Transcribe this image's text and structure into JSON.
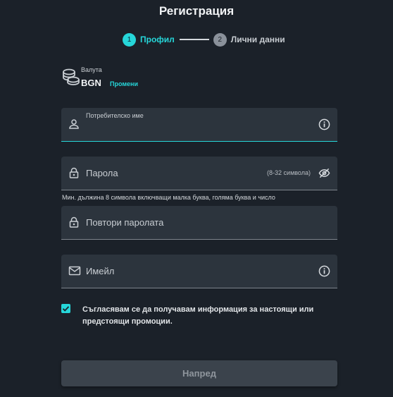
{
  "title": "Регистрация",
  "stepper": {
    "step1": {
      "number": "1",
      "label": "Профил"
    },
    "step2": {
      "number": "2",
      "label": "Лични данни"
    }
  },
  "currency": {
    "label": "Валута",
    "value": "BGN",
    "change": "Промени",
    "icon": "coins-icon"
  },
  "fields": {
    "username": {
      "label": "Потребителско име",
      "value": "",
      "icon": "user-icon",
      "right_icon": "info-icon"
    },
    "password": {
      "placeholder": "Парола",
      "hint": "(8-32 символа)",
      "icon": "lock-icon",
      "right_icon": "eye-off-icon"
    },
    "password_rules": "Мин. дължина 8 символа включващи малка буква, голяма буква и число",
    "repeat_password": {
      "placeholder": "Повтори паролата",
      "icon": "lock-icon"
    },
    "email": {
      "placeholder": "Имейл",
      "icon": "mail-icon",
      "right_icon": "info-icon"
    }
  },
  "consent": {
    "checked": true,
    "text": "Съгласявам се да получавам информация за настоящи или предстоящи промоции."
  },
  "next_button": "Напред",
  "colors": {
    "background": "#1b2129",
    "field": "#2c343d",
    "accent": "#26d6d9"
  }
}
